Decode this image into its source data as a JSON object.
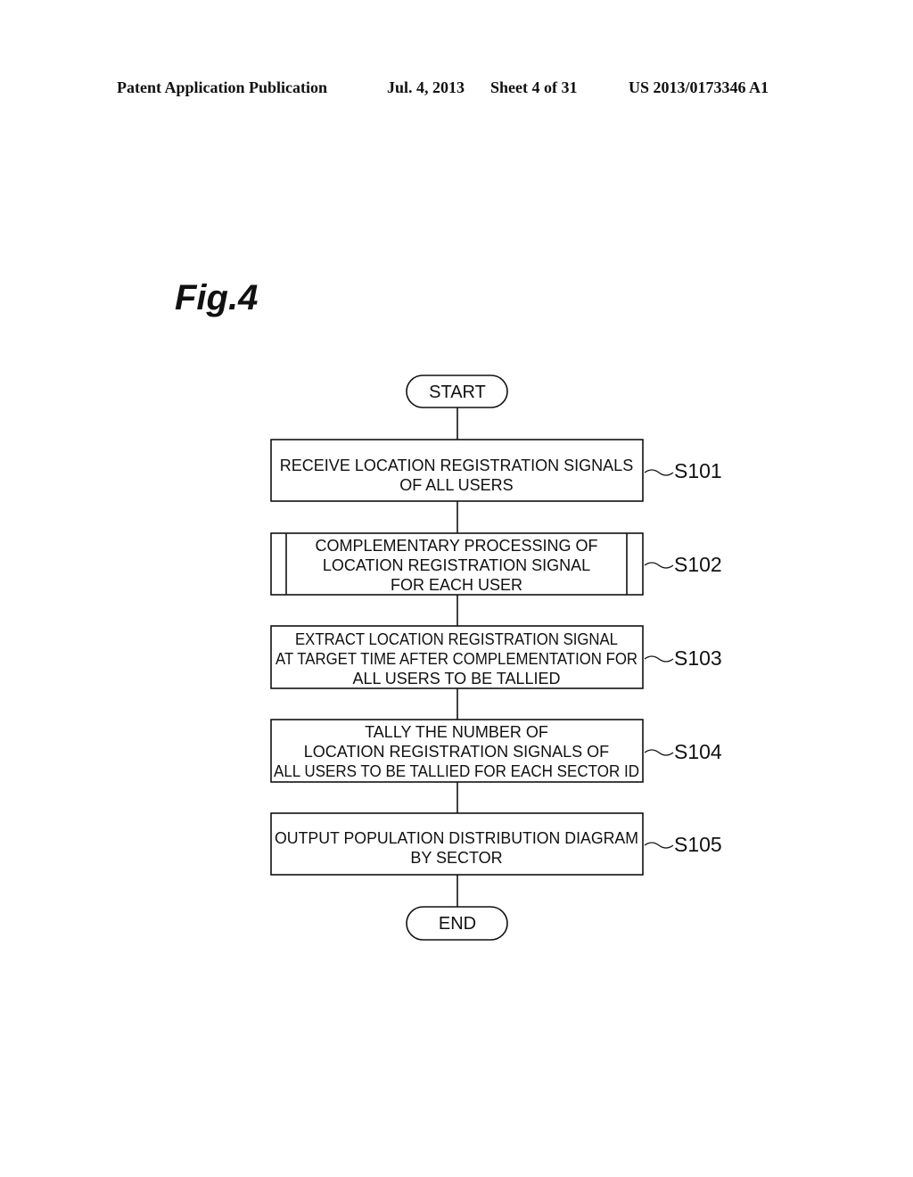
{
  "header": {
    "publication": "Patent Application Publication",
    "date": "Jul. 4, 2013",
    "sheet": "Sheet 4 of 31",
    "number": "US 2013/0173346 A1"
  },
  "figure": {
    "label": "Fig.4",
    "start": "START",
    "end": "END",
    "steps": [
      {
        "id": "S101",
        "type": "process",
        "lines": [
          "RECEIVE LOCATION REGISTRATION SIGNALS",
          "OF ALL USERS"
        ]
      },
      {
        "id": "S102",
        "type": "predefined-process",
        "lines": [
          "COMPLEMENTARY PROCESSING OF",
          "LOCATION REGISTRATION SIGNAL",
          "FOR EACH USER"
        ]
      },
      {
        "id": "S103",
        "type": "process",
        "lines": [
          "EXTRACT LOCATION REGISTRATION SIGNAL",
          "AT TARGET TIME AFTER COMPLEMENTATION FOR",
          "ALL USERS TO BE TALLIED"
        ]
      },
      {
        "id": "S104",
        "type": "process",
        "lines": [
          "TALLY THE NUMBER OF",
          "LOCATION REGISTRATION SIGNALS OF",
          "ALL USERS TO BE TALLIED FOR EACH SECTOR ID"
        ]
      },
      {
        "id": "S105",
        "type": "process",
        "lines": [
          "OUTPUT POPULATION DISTRIBUTION DIAGRAM",
          "BY SECTOR"
        ]
      }
    ]
  }
}
